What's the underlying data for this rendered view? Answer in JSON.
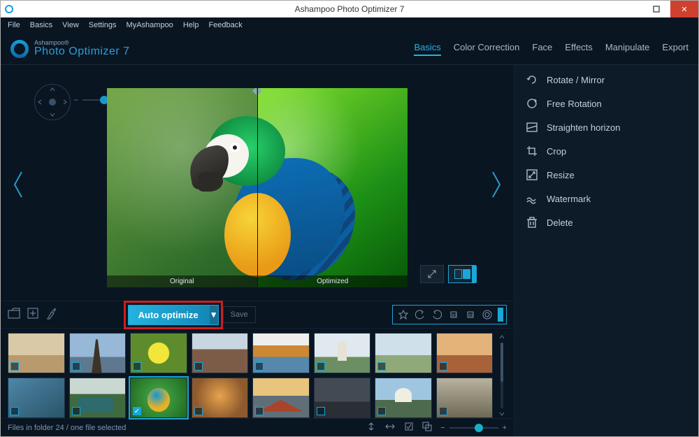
{
  "window": {
    "title": "Ashampoo Photo Optimizer 7"
  },
  "menubar": [
    "File",
    "Basics",
    "View",
    "Settings",
    "MyAshampoo",
    "Help",
    "Feedback"
  ],
  "logo": {
    "brand": "Ashampoo®",
    "product": "Photo Optimizer 7"
  },
  "top_tabs": [
    {
      "label": "Basics",
      "active": true
    },
    {
      "label": "Color Correction"
    },
    {
      "label": "Face"
    },
    {
      "label": "Effects"
    },
    {
      "label": "Manipulate"
    },
    {
      "label": "Export"
    }
  ],
  "compare": {
    "left": "Original",
    "right": "Optimized"
  },
  "toolbar": {
    "auto_optimize": "Auto optimize",
    "save": "Save"
  },
  "side_panel": [
    {
      "name": "rotate-mirror",
      "label": "Rotate / Mirror"
    },
    {
      "name": "free-rotation",
      "label": "Free Rotation"
    },
    {
      "name": "straighten-horizon",
      "label": "Straighten horizon"
    },
    {
      "name": "crop",
      "label": "Crop"
    },
    {
      "name": "resize",
      "label": "Resize"
    },
    {
      "name": "watermark",
      "label": "Watermark"
    },
    {
      "name": "delete",
      "label": "Delete"
    }
  ],
  "status": {
    "text": "Files in folder 24 / one file selected"
  },
  "thumbnails": {
    "selected_index": 10
  }
}
